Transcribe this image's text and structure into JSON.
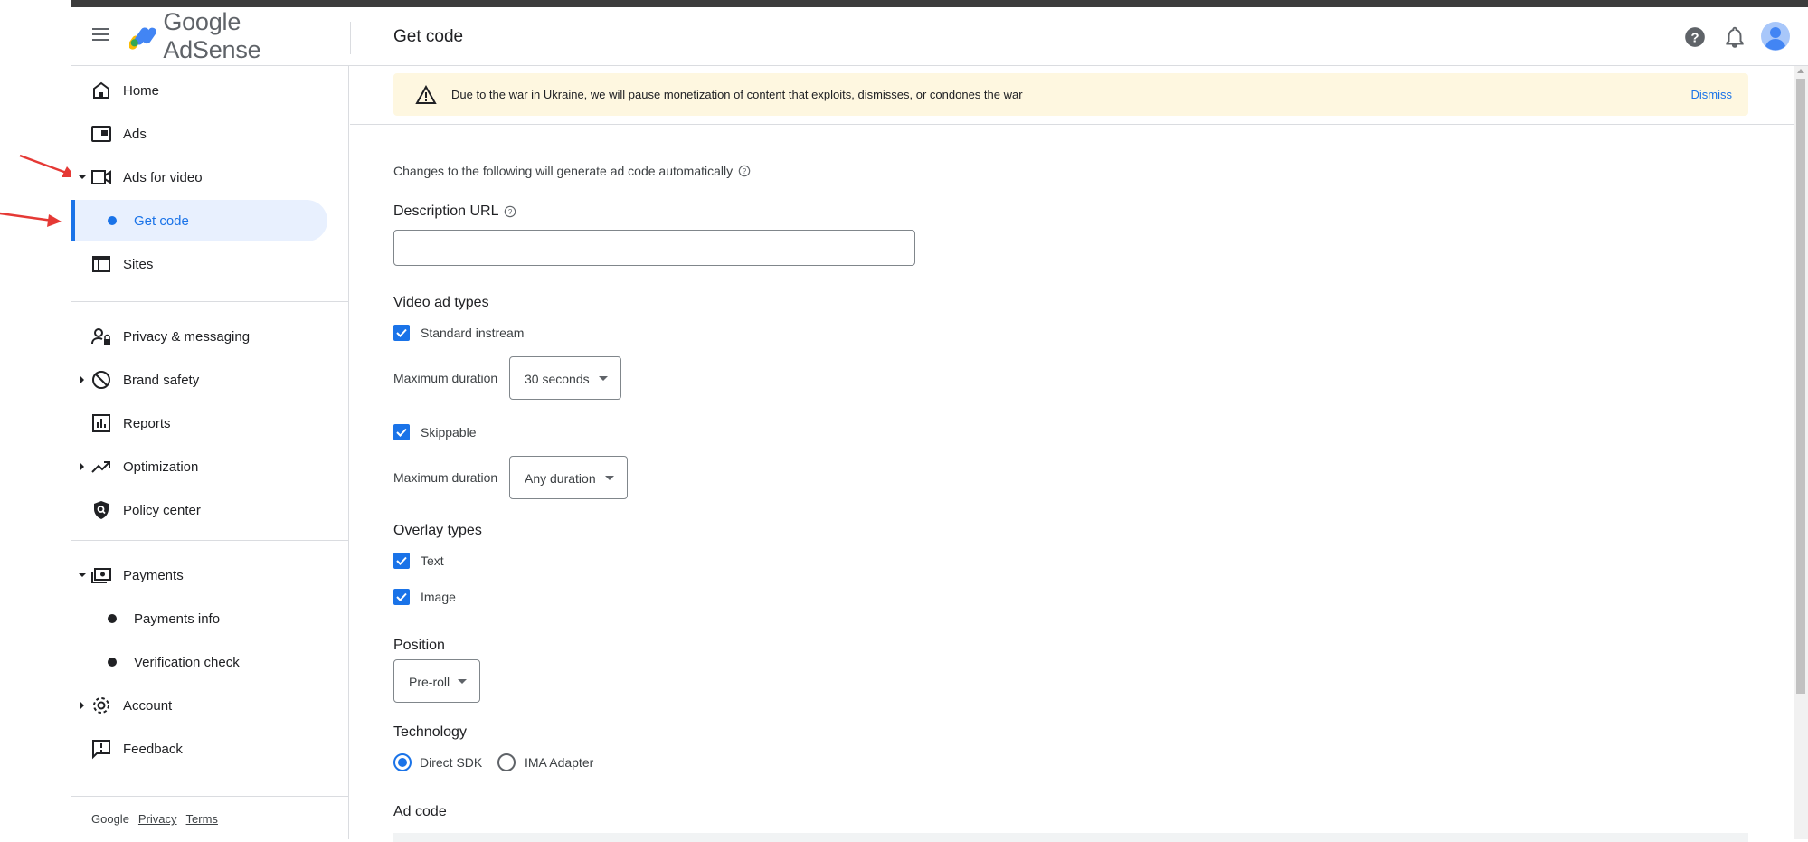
{
  "header": {
    "logo_text": "Google AdSense",
    "page_title": "Get code"
  },
  "sidebar": {
    "items": [
      {
        "label": "Home",
        "icon": "home-icon"
      },
      {
        "label": "Ads",
        "icon": "ads-icon"
      },
      {
        "label": "Ads for video",
        "icon": "video-camera-icon",
        "expanded": true
      },
      {
        "label": "Get code",
        "selected": true
      },
      {
        "label": "Sites",
        "icon": "sites-icon"
      },
      {
        "label": "Privacy & messaging",
        "icon": "privacy-icon"
      },
      {
        "label": "Brand safety",
        "icon": "block-icon"
      },
      {
        "label": "Reports",
        "icon": "reports-icon"
      },
      {
        "label": "Optimization",
        "icon": "trending-icon"
      },
      {
        "label": "Policy center",
        "icon": "policy-shield-icon"
      },
      {
        "label": "Payments",
        "icon": "payments-icon",
        "expanded": true
      },
      {
        "label": "Payments info"
      },
      {
        "label": "Verification check"
      },
      {
        "label": "Account",
        "icon": "gear-icon"
      },
      {
        "label": "Feedback",
        "icon": "feedback-icon"
      }
    ],
    "footer": {
      "google": "Google",
      "privacy": "Privacy",
      "terms": "Terms"
    }
  },
  "banner": {
    "text": "Due to the war in Ukraine, we will pause monetization of content that exploits, dismisses, or condones the war",
    "dismiss": "Dismiss"
  },
  "form": {
    "intro": "Changes to the following will generate ad code automatically",
    "description_url_label": "Description URL",
    "description_url_value": "",
    "video_ad_types_heading": "Video ad types",
    "standard_instream_label": "Standard instream",
    "standard_instream_checked": true,
    "max_duration_label": "Maximum duration",
    "standard_max_duration": "30 seconds",
    "skippable_label": "Skippable",
    "skippable_checked": true,
    "skippable_max_duration": "Any duration",
    "overlay_types_heading": "Overlay types",
    "overlay_text_label": "Text",
    "overlay_text_checked": true,
    "overlay_image_label": "Image",
    "overlay_image_checked": true,
    "position_heading": "Position",
    "position_value": "Pre-roll",
    "technology_heading": "Technology",
    "tech_direct_sdk": "Direct SDK",
    "tech_ima_adapter": "IMA Adapter",
    "tech_selected": "Direct SDK",
    "ad_code_heading": "Ad code"
  },
  "colors": {
    "accent": "#1a73e8",
    "banner_bg": "#fef7e0",
    "active_bg": "#e8f0fe",
    "annotation_arrow": "#e53935"
  }
}
